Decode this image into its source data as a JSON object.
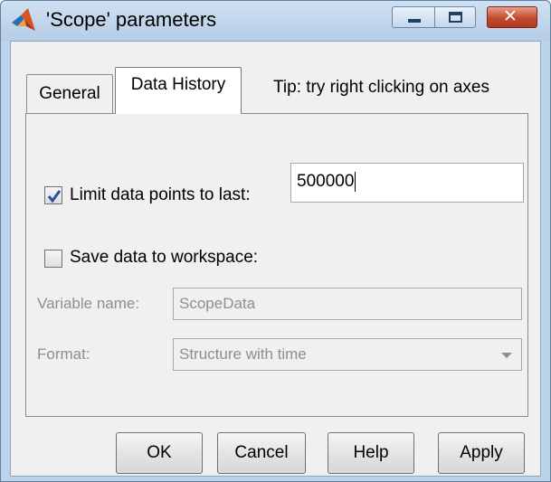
{
  "window": {
    "title": "'Scope' parameters"
  },
  "tabs": [
    {
      "label": "General",
      "selected": false
    },
    {
      "label": "Data History",
      "selected": true
    }
  ],
  "tip": "Tip: try right clicking on axes",
  "data_history": {
    "limit_points": {
      "label": "Limit data points to last:",
      "checked": true,
      "value": "500000"
    },
    "save_workspace": {
      "label": "Save data to workspace:",
      "checked": false
    },
    "variable_name": {
      "label": "Variable name:",
      "value": "ScopeData",
      "enabled": false
    },
    "format": {
      "label": "Format:",
      "value": "Structure with time",
      "enabled": false
    }
  },
  "buttons": {
    "ok": "OK",
    "cancel": "Cancel",
    "help": "Help",
    "apply": "Apply"
  },
  "colors": {
    "titlebar": "#b6cde6",
    "close_button": "#c24a2e",
    "checkmark": "#2a4f9e",
    "disabled_text": "#8e8e8e"
  }
}
